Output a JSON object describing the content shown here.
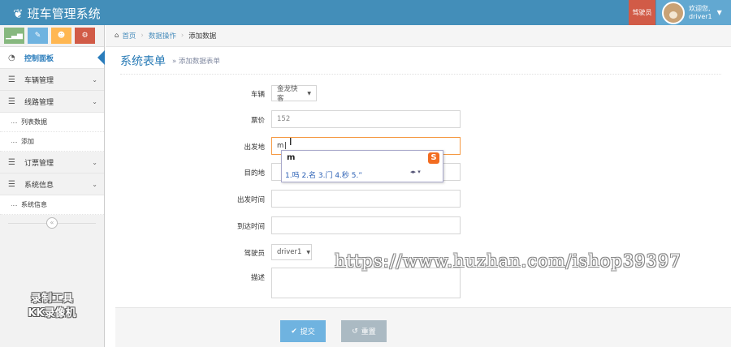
{
  "app": {
    "title": "班车管理系统",
    "role_button": "驾驶员",
    "welcome": "欢迎您,",
    "username": "driver1"
  },
  "sidebar": {
    "items": [
      {
        "label": "控制面板",
        "icon": "dashboard-icon"
      },
      {
        "label": "车辆管理",
        "icon": "list-icon"
      },
      {
        "label": "线路管理",
        "icon": "list-icon"
      },
      {
        "label": "列表数据"
      },
      {
        "label": "添加"
      },
      {
        "label": "订票管理",
        "icon": "list-icon"
      },
      {
        "label": "系统信息",
        "icon": "list-icon"
      },
      {
        "label": "系统信息"
      }
    ],
    "shortcut_colors": [
      "#87b87f",
      "#6fb3e0",
      "#ffb752",
      "#d15b47"
    ]
  },
  "breadcrumb": {
    "home": "首页",
    "section": "数据操作",
    "current": "添加数据"
  },
  "page": {
    "title": "系统表单",
    "subtitle": "» 添加数据表单"
  },
  "form": {
    "vehicle_label": "车辆",
    "vehicle_value": "金龙快客",
    "price_label": "票价",
    "price_value": "152",
    "departure_label": "出发地",
    "departure_value": "m",
    "destination_label": "目的地",
    "depart_time_label": "出发时间",
    "arrive_time_label": "到达时间",
    "driver_label": "驾驶员",
    "driver_value": "driver1",
    "desc_label": "描述",
    "submit_label": "提交",
    "reset_label": "重置"
  },
  "ime": {
    "composition": "m",
    "candidates": "1.吗  2.名  3.门  4.秒  5.”",
    "logo": "S"
  },
  "watermarks": {
    "recorder_line1": "录制工具",
    "recorder_line2": "KK录像机",
    "url": "https://www.huzhan.com/ishop39397"
  }
}
